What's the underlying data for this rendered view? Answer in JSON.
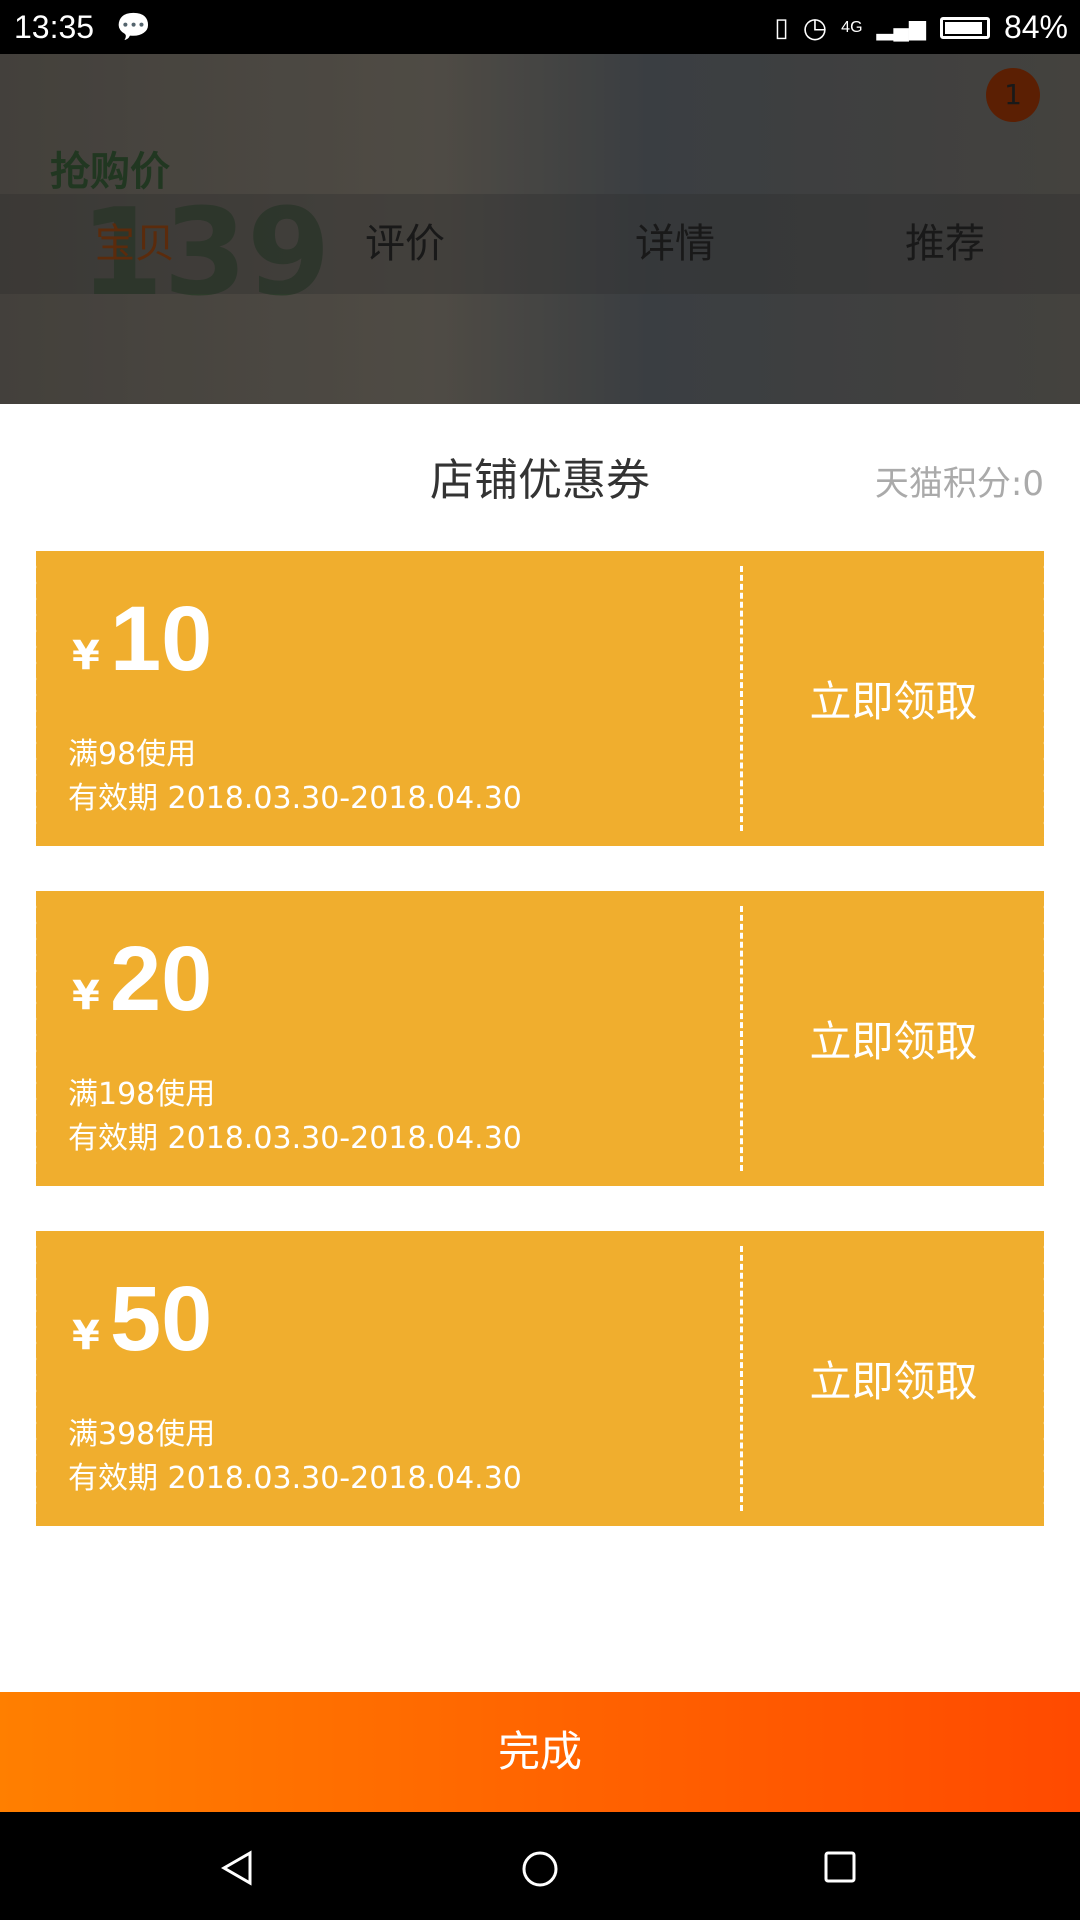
{
  "status_bar": {
    "time": "13:35",
    "battery": "84%",
    "network": "4G"
  },
  "background": {
    "price_label": "抢购价",
    "price": "139",
    "cart_badge": "1",
    "tabs": [
      {
        "label": "宝贝",
        "active": true
      },
      {
        "label": "评价"
      },
      {
        "label": "详情"
      },
      {
        "label": "推荐"
      }
    ]
  },
  "sheet": {
    "title": "店铺优惠券",
    "points": "天猫积分:0"
  },
  "coupons": [
    {
      "currency": "¥",
      "amount": "10",
      "condition": "满98使用",
      "validity": "有效期 2018.03.30-2018.04.30",
      "claim": "立即领取"
    },
    {
      "currency": "¥",
      "amount": "20",
      "condition": "满198使用",
      "validity": "有效期 2018.03.30-2018.04.30",
      "claim": "立即领取"
    },
    {
      "currency": "¥",
      "amount": "50",
      "condition": "满398使用",
      "validity": "有效期 2018.03.30-2018.04.30",
      "claim": "立即领取"
    }
  ],
  "done_button": "完成",
  "colors": {
    "coupon": "#f0ae2e",
    "button_start": "#ff7f00",
    "button_end": "#ff4a00"
  }
}
